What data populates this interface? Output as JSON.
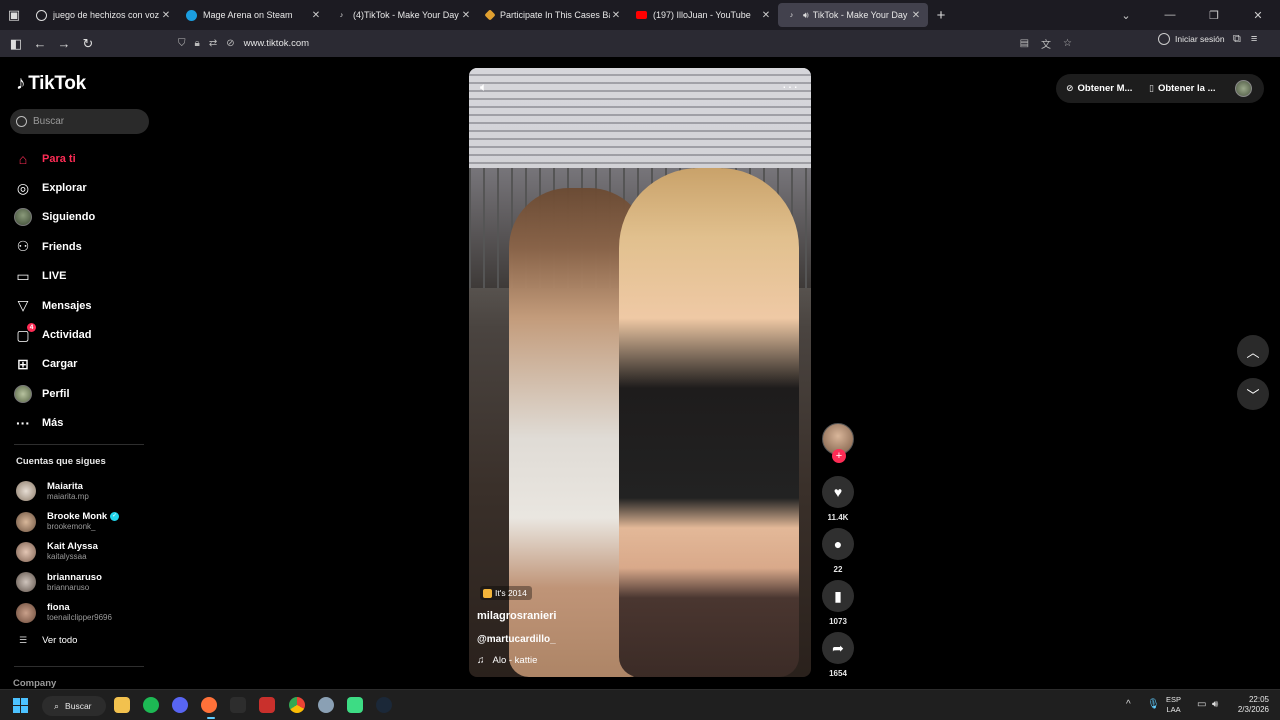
{
  "browser": {
    "tabs": [
      {
        "title": "juego de hechizos con voz - Bu",
        "fav_color": "#e8e8e8",
        "active": false
      },
      {
        "title": "Mage Arena on Steam",
        "fav_color": "#1b9ee0",
        "active": false
      },
      {
        "title": "(4)TikTok - Make Your Day",
        "fav_color": "#000000",
        "active": false
      },
      {
        "title": "Participate In This Cases Battle!",
        "fav_color": "#e0a030",
        "active": false
      },
      {
        "title": "(197) IlloJuan - YouTube",
        "fav_color": "#ff0000",
        "active": false
      },
      {
        "title": "TikTok - Make Your Day",
        "fav_color": "#000000",
        "active": true
      }
    ],
    "url": "www.tiktok.com",
    "signin_label": "Iniciar sesión"
  },
  "tiktok": {
    "logo": "TikTok",
    "search_placeholder": "Buscar",
    "menu": [
      {
        "label": "Para ti",
        "icon": "home-icon",
        "active": true
      },
      {
        "label": "Explorar",
        "icon": "compass-icon",
        "active": false
      },
      {
        "label": "Siguiendo",
        "icon": "following-avatar-icon",
        "active": false
      },
      {
        "label": "Friends",
        "icon": "friends-icon",
        "active": false
      },
      {
        "label": "LIVE",
        "icon": "live-icon",
        "active": false
      },
      {
        "label": "Mensajes",
        "icon": "send-icon",
        "active": false
      },
      {
        "label": "Actividad",
        "icon": "activity-icon",
        "active": false,
        "badge": "4"
      },
      {
        "label": "Cargar",
        "icon": "upload-icon",
        "active": false
      },
      {
        "label": "Perfil",
        "icon": "profile-avatar-icon",
        "active": false
      },
      {
        "label": "Más",
        "icon": "more-icon",
        "active": false
      }
    ],
    "following_header": "Cuentas que sigues",
    "following": [
      {
        "name": "Maiarita",
        "handle": "maiarita.mp",
        "verified": false
      },
      {
        "name": "Brooke Monk",
        "handle": "brookemonk_",
        "verified": true
      },
      {
        "name": "Kait Alyssa",
        "handle": "kaitalyssaa",
        "verified": false
      },
      {
        "name": "briannaruso",
        "handle": "briannaruso",
        "verified": false
      },
      {
        "name": "fiona",
        "handle": "toenailclipper9696",
        "verified": false
      }
    ],
    "see_all": "Ver todo",
    "company": "Company",
    "top_right": {
      "get_1": "Obtener M...",
      "get_2": "Obtener la ..."
    },
    "video": {
      "tag": "It's 2014",
      "author": "milagrosranieri",
      "mention": "@martucardillo_",
      "music": "Alo - kattie"
    },
    "actions": {
      "likes": "11.4K",
      "comments": "22",
      "saves": "1073",
      "shares": "1654"
    }
  },
  "taskbar": {
    "search_label": "Buscar",
    "lang_1": "ESP",
    "lang_2": "LAA",
    "time": "22:05",
    "date": "2/3/2026"
  }
}
